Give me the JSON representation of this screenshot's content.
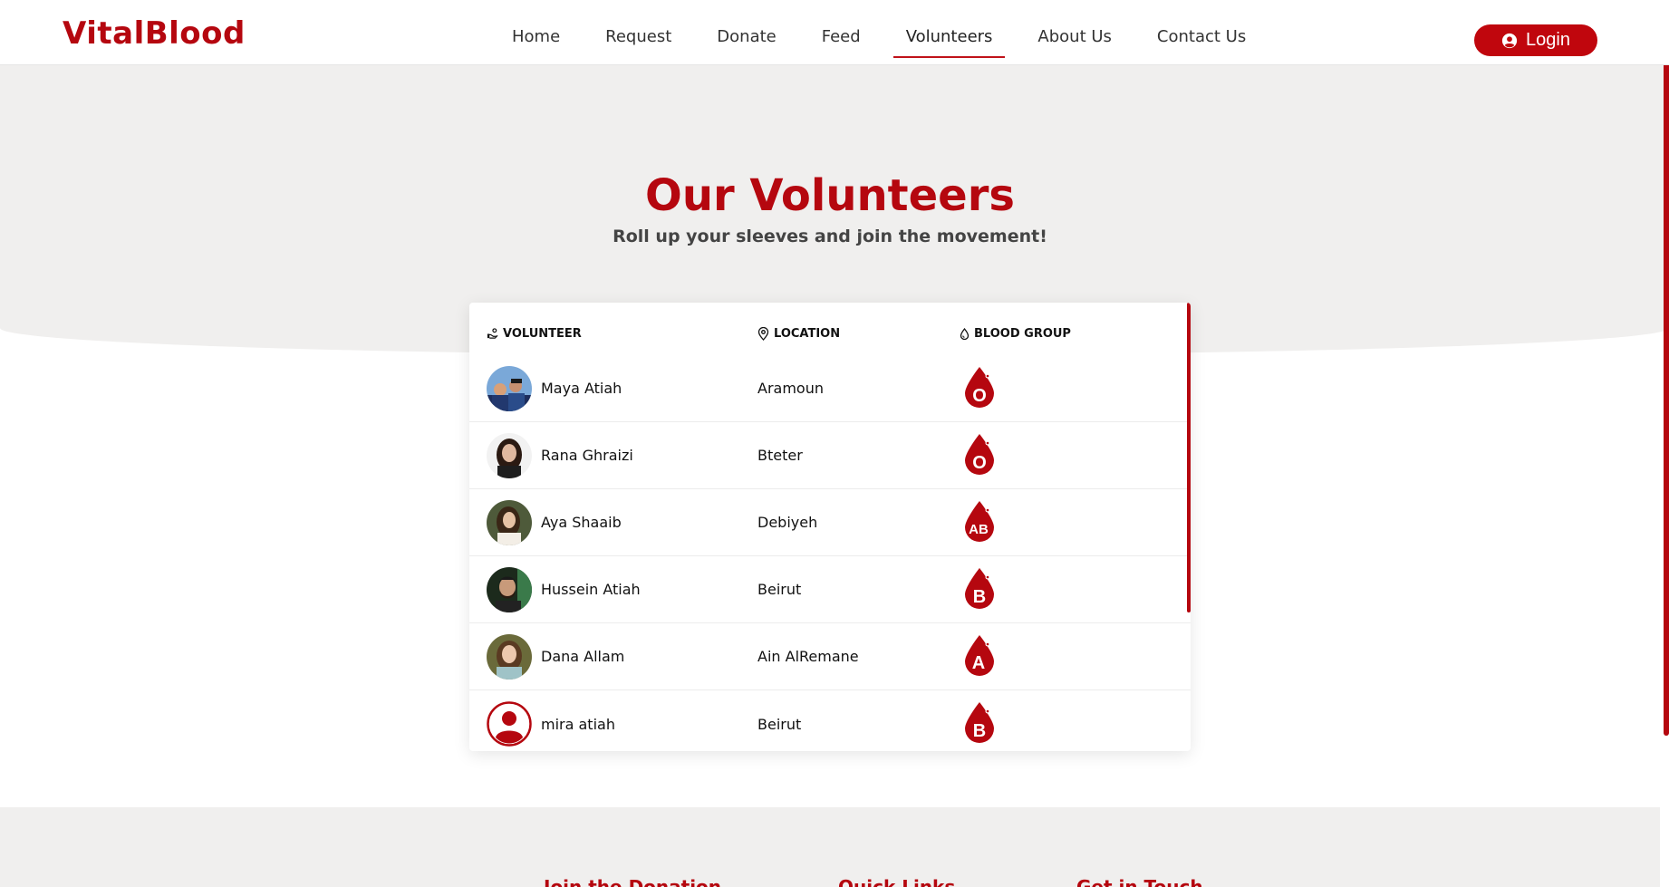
{
  "brand": {
    "name": "VitalBlood",
    "accent": "#b5070f"
  },
  "nav": {
    "items": [
      {
        "label": "Home"
      },
      {
        "label": "Request"
      },
      {
        "label": "Donate"
      },
      {
        "label": "Feed"
      },
      {
        "label": "Volunteers",
        "active": true
      },
      {
        "label": "About Us"
      },
      {
        "label": "Contact Us"
      }
    ],
    "login_label": "Login"
  },
  "hero": {
    "title": "Our Volunteers",
    "subtitle": "Roll up your sleeves and join the movement!"
  },
  "table": {
    "headers": {
      "volunteer": "VOLUNTEER",
      "location": "LOCATION",
      "blood_group": "BLOOD GROUP"
    },
    "rows": [
      {
        "name": "Maya Atiah",
        "location": "Aramoun",
        "blood_group": "O",
        "avatar": "photo-group"
      },
      {
        "name": "Rana Ghraizi",
        "location": "Bteter",
        "blood_group": "O",
        "avatar": "photo-woman"
      },
      {
        "name": "Aya Shaaib",
        "location": "Debiyeh",
        "blood_group": "AB",
        "avatar": "photo-woman"
      },
      {
        "name": "Hussein Atiah",
        "location": "Beirut",
        "blood_group": "B",
        "avatar": "photo-man"
      },
      {
        "name": "Dana Allam",
        "location": "Ain AlRemane",
        "blood_group": "A",
        "avatar": "photo-woman"
      },
      {
        "name": "mira atiah",
        "location": "Beirut",
        "blood_group": "B",
        "avatar": "default-user-icon"
      }
    ]
  },
  "footer": {
    "headings": [
      "Join the Donation",
      "Quick Links",
      "Get in Touch"
    ]
  }
}
